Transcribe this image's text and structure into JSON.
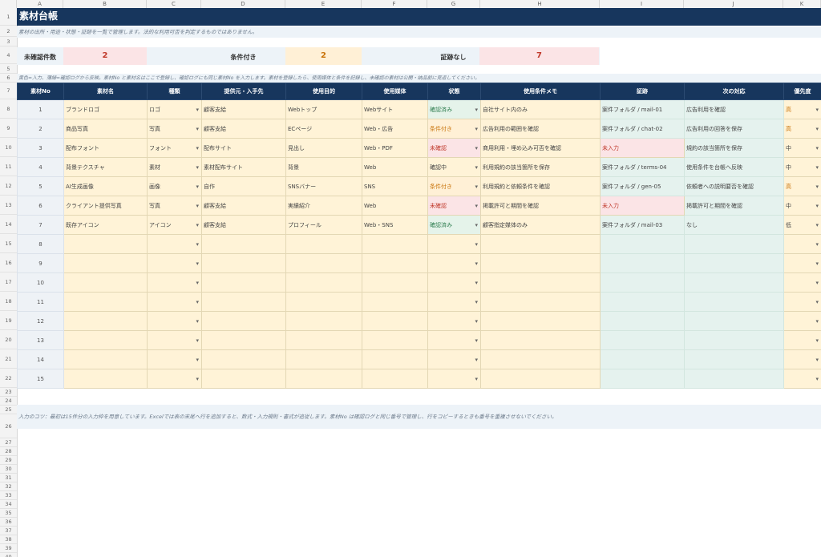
{
  "columns": [
    "A",
    "B",
    "C",
    "D",
    "E",
    "F",
    "G",
    "H",
    "I",
    "J",
    "K"
  ],
  "row_numbers": [
    "1",
    "2",
    "3",
    "4",
    "5",
    "6",
    "7",
    "8",
    "9",
    "10",
    "11",
    "12",
    "13",
    "14",
    "15",
    "16",
    "17",
    "18",
    "19",
    "20",
    "21",
    "22",
    "23",
    "24",
    "25",
    "26",
    "27",
    "28",
    "29",
    "30",
    "31",
    "32",
    "33",
    "34",
    "35",
    "36",
    "37",
    "38",
    "39",
    "40",
    "41",
    "42"
  ],
  "title": "素材台帳",
  "subtitle": "素材の出所・用途・状態・証跡を一覧で管理します。法的な利用可否を判定するものではありません。",
  "summary": {
    "unconfirmed_label": "未確認件数",
    "unconfirmed_value": "2",
    "conditional_label": "条件付き",
    "conditional_value": "2",
    "no_evidence_label": "証跡なし",
    "no_evidence_value": "7"
  },
  "legend_note": "黄色=入力、薄緑=確認ログから反映。素材No と素材名はここで登録し、確認ログにも同じ素材No を入力します。素材を登録したら、使用媒体と条件を記録し、未確認の素材は公開・納品前に見返してください。",
  "headers": [
    "素材No",
    "素材名",
    "種類",
    "提供元・入手先",
    "使用目的",
    "使用媒体",
    "状態",
    "使用条件メモ",
    "証跡",
    "次の対応",
    "優先度"
  ],
  "rows": [
    {
      "no": "1",
      "name": "ブランドロゴ",
      "kind": "ロゴ",
      "source": "顧客支給",
      "purpose": "Webトップ",
      "media": "Webサイト",
      "status": "確認済み",
      "status_class": "ok",
      "memo": "自社サイト内のみ",
      "evidence": "案件フォルダ / mail-01",
      "next": "広告利用を確認",
      "priority": "高"
    },
    {
      "no": "2",
      "name": "商品写真",
      "kind": "写真",
      "source": "顧客支給",
      "purpose": "ECページ",
      "media": "Web・広告",
      "status": "条件付き",
      "status_class": "cond",
      "memo": "広告利用の範囲を確認",
      "evidence": "案件フォルダ / chat-02",
      "next": "広告利用の回答を保存",
      "priority": "高"
    },
    {
      "no": "3",
      "name": "配布フォント",
      "kind": "フォント",
      "source": "配布サイト",
      "purpose": "見出し",
      "media": "Web・PDF",
      "status": "未確認",
      "status_class": "un",
      "memo": "商用利用・埋め込み可否を確認",
      "evidence": "未入力",
      "evidence_missing": true,
      "next": "規約の該当箇所を保存",
      "priority": "中"
    },
    {
      "no": "4",
      "name": "背景テクスチャ",
      "kind": "素材",
      "source": "素材配布サイト",
      "purpose": "背景",
      "media": "Web",
      "status": "確認中",
      "status_class": "",
      "memo": "利用規約の該当箇所を保存",
      "evidence": "案件フォルダ / terms-04",
      "next": "使用条件を台帳へ反映",
      "priority": "中"
    },
    {
      "no": "5",
      "name": "AI生成画像",
      "kind": "画像",
      "source": "自作",
      "purpose": "SNSバナー",
      "media": "SNS",
      "status": "条件付き",
      "status_class": "cond",
      "memo": "利用規約と依頼条件を確認",
      "evidence": "案件フォルダ / gen-05",
      "next": "依頼者への説明要否を確認",
      "priority": "高"
    },
    {
      "no": "6",
      "name": "クライアント提供写真",
      "kind": "写真",
      "source": "顧客支給",
      "purpose": "実績紹介",
      "media": "Web",
      "status": "未確認",
      "status_class": "un",
      "memo": "掲載許可と期間を確認",
      "evidence": "未入力",
      "evidence_missing": true,
      "next": "掲載許可と期間を確認",
      "priority": "中"
    },
    {
      "no": "7",
      "name": "既存アイコン",
      "kind": "アイコン",
      "source": "顧客支給",
      "purpose": "プロフィール",
      "media": "Web・SNS",
      "status": "確認済み",
      "status_class": "ok",
      "memo": "顧客指定媒体のみ",
      "evidence": "案件フォルダ / mail-03",
      "next": "なし",
      "priority": "低"
    },
    {
      "no": "8"
    },
    {
      "no": "9"
    },
    {
      "no": "10"
    },
    {
      "no": "11"
    },
    {
      "no": "12"
    },
    {
      "no": "13"
    },
    {
      "no": "14"
    },
    {
      "no": "15"
    }
  ],
  "tip": "入力のコツ：最初は15件分の入力枠を用意しています。Excelでは表の末尾へ行を追加すると、数式・入力規則・書式が追従します。素材No は確認ログと同じ番号で管理し、行をコピーするときも番号を重複させないでください。",
  "colors": {
    "header": "#17365d",
    "input": "#fff3d7",
    "reflected": "#e5f2ee",
    "danger": "#c0392b",
    "warning": "#c9730a",
    "ok": "#2e7d4f"
  }
}
